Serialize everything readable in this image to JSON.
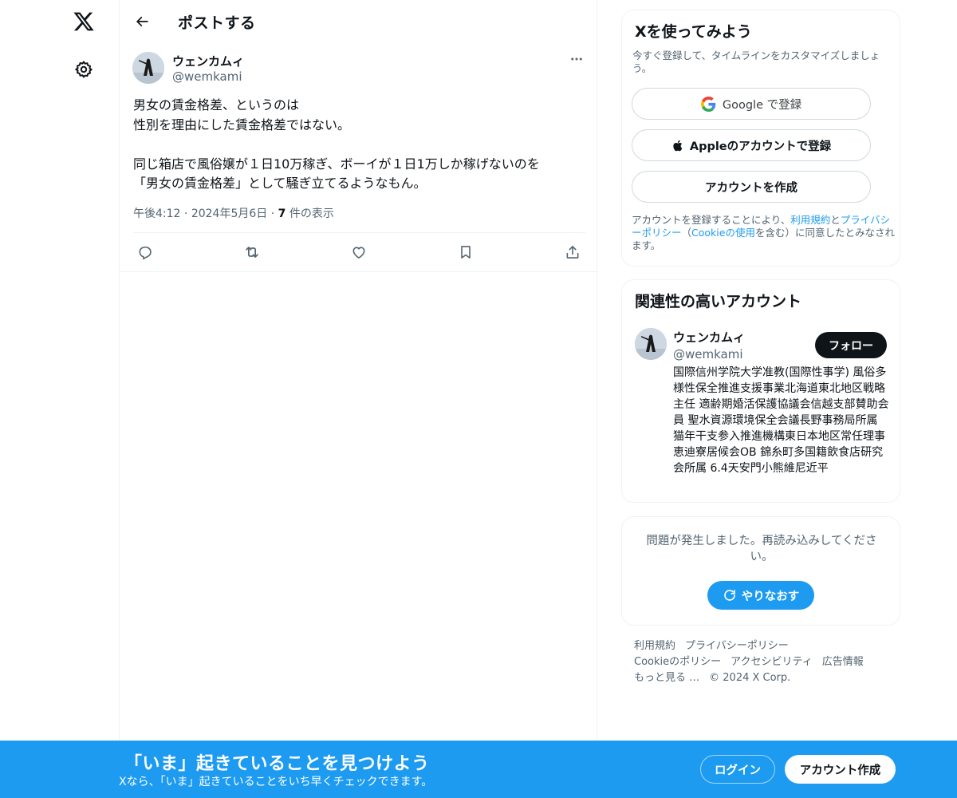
{
  "nav": {
    "logo_icon": "x-logo-icon",
    "settings_icon": "gear-icon"
  },
  "header": {
    "title": "ポストする",
    "back_icon": "arrow-left-icon"
  },
  "post": {
    "author_name": "ウェンカムィ",
    "author_handle": "@wemkami",
    "text": "男女の賃金格差、というのは\n性別を理由にした賃金格差ではない。\n\n同じ箱店で風俗嬢が１日10万稼ぎ、ボーイが１日1万しか稼げないのを\n「男女の賃金格差」として騒ぎ立てるようなもん。",
    "time": "午後4:12",
    "sep1": "·",
    "date": "2024年5月6日",
    "sep2": "·",
    "views_count": "7",
    "views_label": "件の表示",
    "actions": [
      "reply-icon",
      "retweet-icon",
      "like-icon",
      "bookmark-icon",
      "share-icon"
    ]
  },
  "signup_card": {
    "title": "Xを使ってみよう",
    "subtitle": "今すぐ登録して、タイムラインをカスタマイズしましょう。",
    "google_label": "Google で登録",
    "apple_label": "Appleのアカウントで登録",
    "create_label": "アカウントを作成",
    "legal_prefix": "アカウントを登録することにより、",
    "legal_terms": "利用規約",
    "legal_and": "と",
    "legal_privacy": "プライバシーポリシー",
    "legal_paren_open": "（",
    "legal_cookie": "Cookieの使用",
    "legal_suffix": "を含む）に同意したとみなされます。"
  },
  "related_card": {
    "title": "関連性の高いアカウント",
    "name": "ウェンカムィ",
    "handle": "@wemkami",
    "follow_label": "フォロー",
    "bio": "国際信州学院大学准教(国際性事学) 風俗多様性保全推進支援事業北海道東北地区戦略主任 適齢期婚活保護協議会信越支部賛助会員 聖水資源環境保全会議長野事務局所属 猫年干支参入推進機構東日本地区常任理事 恵迪寮居候会OB 錦糸町多国籍飲食店研究会所属 6.4天安門小熊維尼近平"
  },
  "error_card": {
    "message": "問題が発生しました。再読み込みしてください。",
    "retry_label": "やりなおす"
  },
  "footer": {
    "links": [
      "利用規約",
      "プライバシーポリシー",
      "Cookieのポリシー",
      "アクセシビリティ",
      "広告情報",
      "もっと見る …"
    ],
    "copyright": "© 2024 X Corp."
  },
  "bottom_bar": {
    "title": "「いま」起きていることを見つけよう",
    "subtitle": "Xなら、「いま」起きていることをいち早くチェックできます。",
    "login_label": "ログイン",
    "signup_label": "アカウント作成"
  },
  "colors": {
    "accent": "#1d9bf0",
    "text": "#0f1419",
    "muted": "#536471",
    "border": "#eff3f4"
  }
}
